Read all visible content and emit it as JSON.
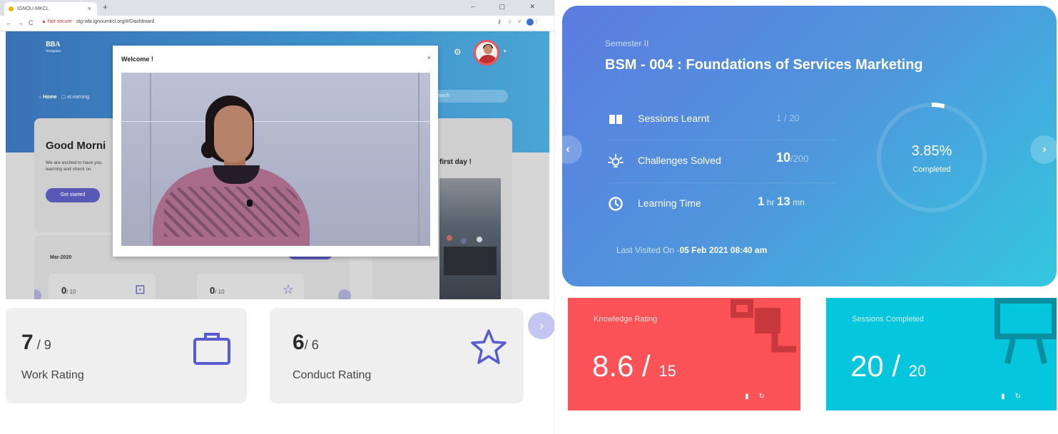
{
  "browser": {
    "tab_title": "IGNOU-MKCL",
    "tab_close": "×",
    "new_tab": "+",
    "window_controls": "– ▢ ✕",
    "not_secure": "Not secure",
    "url": "stg-wbi.ignoumkcl.org/#/Dashboard"
  },
  "portal": {
    "brand_title": "BBA",
    "brand_sub": "Workplace",
    "crumb_home": "Home",
    "crumb_elearning": "eLearning",
    "search_placeholder": "Search",
    "greeting": "Good Morni",
    "greeting_text": "We are excited to have you learning and check ou",
    "get_started": "Get started",
    "first_day": "first day !",
    "month": "Mar-2020",
    "view_all": "View All",
    "mini_left_value": "0",
    "mini_left_total": "/ 10",
    "mini_right_value": "0",
    "mini_right_total": "/ 10"
  },
  "modal": {
    "title": "Welcome !",
    "close": "×"
  },
  "ratings": {
    "work_value": "7",
    "work_total": "/ 9",
    "work_label": "Work Rating",
    "conduct_value": "6",
    "conduct_total": "/ 6",
    "conduct_label": "Conduct Rating",
    "next_arrow": "›"
  },
  "course": {
    "semester": "Semester II",
    "title": "BSM - 004 : Foundations of Services Marketing",
    "sessions_label": "Sessions Learnt",
    "sessions_value": "1 / 20",
    "challenges_label": "Challenges Solved",
    "challenges_value": "10",
    "challenges_total": "/200",
    "time_label": "Learning Time",
    "time_hours": "1",
    "time_hr_unit": " hr ",
    "time_minutes": "13",
    "time_mn_unit": " mn",
    "last_visited_prefix": "Last Visited On -",
    "last_visited_value": "05 Feb 2021 08:40 am",
    "completion_percent": "3.85%",
    "completion_fraction": 0.0385,
    "completion_caption": "Completed",
    "prev_arrow": "‹",
    "next_arrow": "›"
  },
  "tiles": {
    "knowledge_label": "Knowledge Rating",
    "knowledge_value": "8.6 / ",
    "knowledge_total": "15",
    "sessions_label": "Sessions Completed",
    "sessions_value": "20 / ",
    "sessions_total": "20"
  },
  "colors": {
    "accent_purple": "#5859b7",
    "knowledge_tile": "#fa5257",
    "sessions_tile": "#05c6dc"
  }
}
